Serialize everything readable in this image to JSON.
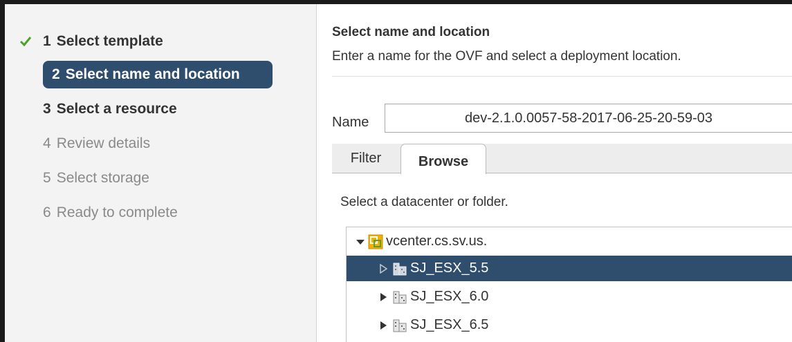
{
  "wizard": {
    "steps": [
      {
        "num": "1",
        "label": "Select template",
        "state": "done"
      },
      {
        "num": "2",
        "label": "Select name and location",
        "state": "active"
      },
      {
        "num": "3",
        "label": "Select a resource",
        "state": "next"
      },
      {
        "num": "4",
        "label": "Review details",
        "state": "pending"
      },
      {
        "num": "5",
        "label": "Select storage",
        "state": "pending"
      },
      {
        "num": "6",
        "label": "Ready to complete",
        "state": "pending"
      }
    ]
  },
  "content": {
    "title": "Select name and location",
    "description": "Enter a name for the OVF and select a deployment location.",
    "name_label": "Name",
    "name_value": "dev-2.1.0.0057-58-2017-06-25-20-59-03",
    "tabs": [
      {
        "label": "Filter",
        "active": false
      },
      {
        "label": "Browse",
        "active": true
      }
    ],
    "hint": "Select a datacenter or folder."
  },
  "tree": {
    "root": {
      "label": "vcenter.cs.sv.us.",
      "icon": "vcenter-icon",
      "expanded": true
    },
    "children": [
      {
        "label": "SJ_ESX_5.5",
        "icon": "datacenter-icon",
        "selected": true
      },
      {
        "label": "SJ_ESX_6.0",
        "icon": "datacenter-icon",
        "selected": false
      },
      {
        "label": "SJ_ESX_6.5",
        "icon": "datacenter-icon",
        "selected": false
      }
    ]
  },
  "colors": {
    "selection": "#2f4d6d",
    "check": "#4aa32a",
    "nav_bg": "#f3f3f3"
  }
}
